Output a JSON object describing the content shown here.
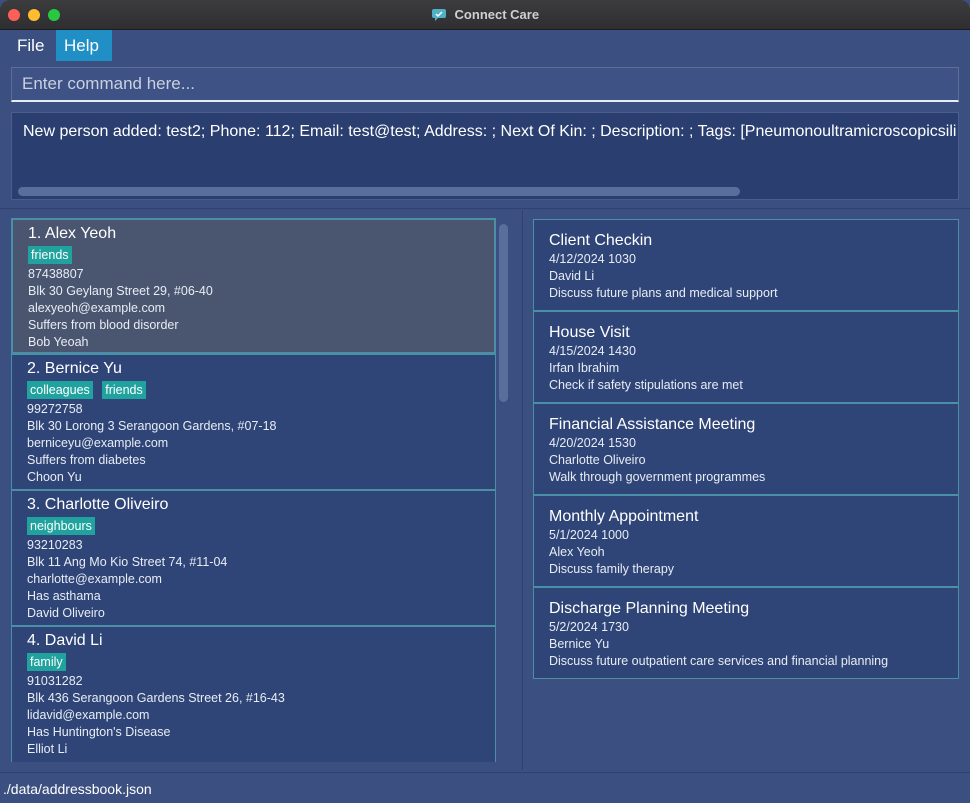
{
  "window": {
    "title": "Connect Care"
  },
  "menu": {
    "file": "File",
    "help": "Help"
  },
  "command": {
    "placeholder": "Enter command here..."
  },
  "result": {
    "text": "New person added: test2; Phone: 112; Email: test@test; Address: ; Next Of Kin: ; Description: ; Tags: [Pneumonoultramicroscopicsili"
  },
  "persons": [
    {
      "index": "1.",
      "name": "Alex Yeoh",
      "tags": [
        "friends"
      ],
      "phone": "87438807",
      "address": "Blk 30 Geylang Street 29, #06-40",
      "email": "alexyeoh@example.com",
      "description": "Suffers from blood disorder",
      "next_of_kin": "Bob Yeoah"
    },
    {
      "index": "2.",
      "name": "Bernice Yu",
      "tags": [
        "colleagues",
        "friends"
      ],
      "phone": "99272758",
      "address": "Blk 30 Lorong 3 Serangoon Gardens, #07-18",
      "email": "berniceyu@example.com",
      "description": "Suffers from diabetes",
      "next_of_kin": "Choon Yu"
    },
    {
      "index": "3.",
      "name": "Charlotte Oliveiro",
      "tags": [
        "neighbours"
      ],
      "phone": "93210283",
      "address": "Blk 11 Ang Mo Kio Street 74, #11-04",
      "email": "charlotte@example.com",
      "description": "Has asthama",
      "next_of_kin": "David Oliveiro"
    },
    {
      "index": "4.",
      "name": "David Li",
      "tags": [
        "family"
      ],
      "phone": "91031282",
      "address": "Blk 436 Serangoon Gardens Street 26, #16-43",
      "email": "lidavid@example.com",
      "description": "Has Huntington's Disease",
      "next_of_kin": "Elliot Li"
    }
  ],
  "appointments": [
    {
      "title": "Client Checkin",
      "datetime": "4/12/2024 1030",
      "person": "David Li",
      "description": "Discuss future plans and medical support"
    },
    {
      "title": "House Visit",
      "datetime": "4/15/2024 1430",
      "person": "Irfan Ibrahim",
      "description": "Check if safety stipulations are met"
    },
    {
      "title": "Financial Assistance Meeting",
      "datetime": "4/20/2024 1530",
      "person": "Charlotte Oliveiro",
      "description": "Walk through government programmes"
    },
    {
      "title": "Monthly Appointment",
      "datetime": "5/1/2024 1000",
      "person": "Alex Yeoh",
      "description": "Discuss family therapy"
    },
    {
      "title": "Discharge Planning Meeting",
      "datetime": "5/2/2024 1730",
      "person": "Bernice Yu",
      "description": "Discuss future outpatient care services and financial planning"
    }
  ],
  "status": {
    "path": "./data/addressbook.json"
  }
}
